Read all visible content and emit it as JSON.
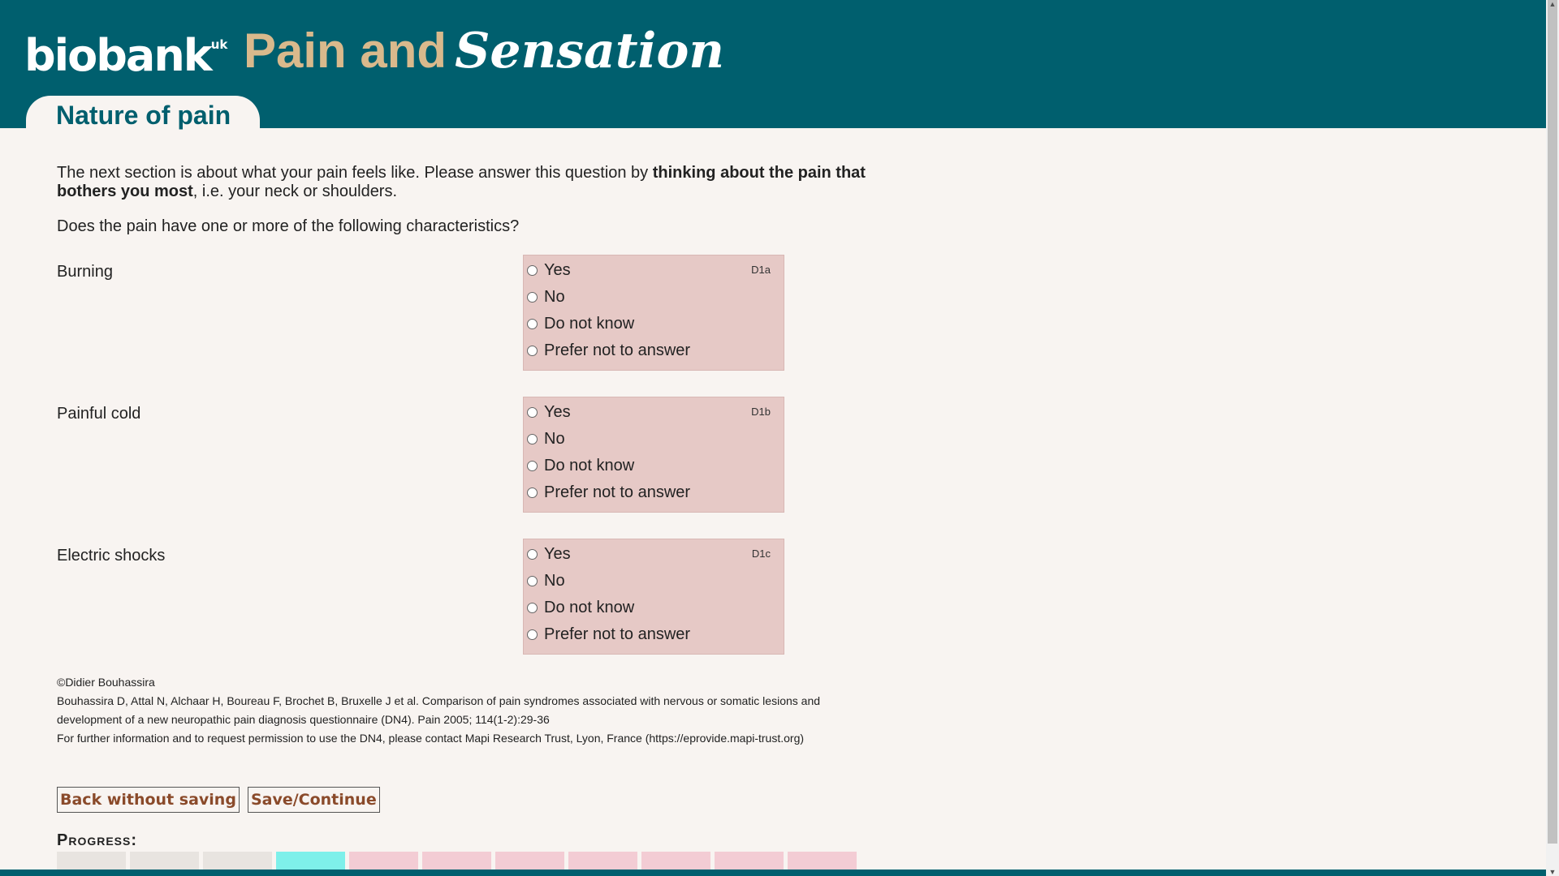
{
  "header": {
    "logo_text": "biobank",
    "logo_sup": "uk",
    "title_part1": "Pain and",
    "title_part2": "Sensation"
  },
  "page_tab": {
    "label": "Nature of pain"
  },
  "intro": {
    "text_before": "The next section is about what your pain feels like. Please answer this question by ",
    "text_bold": "thinking about the pain that bothers you most",
    "text_after": ", i.e. your neck or shoulders."
  },
  "question": "Does the pain have one or more of the following characteristics?",
  "options": [
    "Yes",
    "No",
    "Do not know",
    "Prefer not to answer"
  ],
  "items": [
    {
      "label": "Burning",
      "code": "D1a"
    },
    {
      "label": "Painful cold",
      "code": "D1b"
    },
    {
      "label": "Electric shocks",
      "code": "D1c"
    }
  ],
  "credits": {
    "line1": "©Didier Bouhassira",
    "line2": "Bouhassira D, Attal N, Alchaar H, Boureau F, Brochet B, Bruxelle J et al. Comparison of pain syndromes associated with nervous or somatic lesions and development of a new neuropathic pain diagnosis questionnaire (DN4). Pain 2005; 114(1-2):29-36",
    "line3": "For further information and to request permission to use the DN4, please contact Mapi Research Trust, Lyon, France (https://eprovide.mapi-trust.org)"
  },
  "buttons": {
    "back_label": "Back without saving",
    "save_label": "Save/Continue"
  },
  "progress": {
    "label": "Progress:",
    "segments": [
      "done",
      "done",
      "done",
      "current",
      "todo",
      "todo",
      "todo",
      "todo",
      "todo",
      "todo",
      "todo"
    ],
    "colors": {
      "done": "#e8e4e0",
      "current": "#7ef0ea",
      "todo": "#f3ccd4"
    }
  },
  "colors": {
    "header_bg": "#005f6e",
    "title_accent": "#d9b98c",
    "option_box": "#e6c9c6"
  }
}
